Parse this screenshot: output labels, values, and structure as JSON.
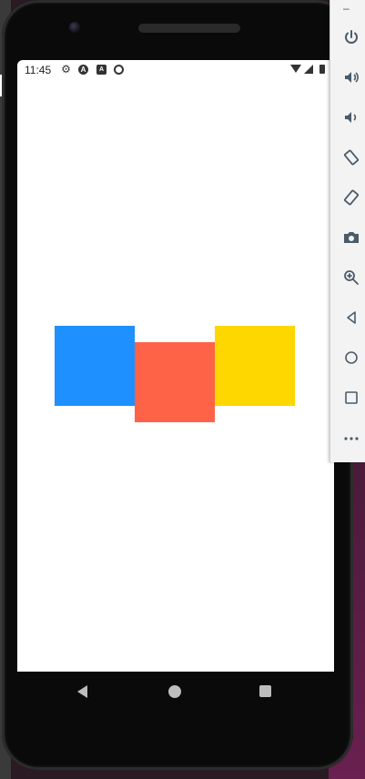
{
  "statusbar": {
    "time": "11:45",
    "icons": [
      "settings-icon",
      "a-icon",
      "a-box-icon",
      "sync-icon",
      "wifi-icon",
      "signal-icon",
      "battery-icon"
    ],
    "a_glyph": "A",
    "b_glyph": "A"
  },
  "app": {
    "boxes": [
      {
        "name": "blue-box",
        "color": "#1e90ff"
      },
      {
        "name": "red-box",
        "color": "#ff6347"
      },
      {
        "name": "yellow-box",
        "color": "#ffd700"
      }
    ]
  },
  "navbar": {
    "buttons": [
      "back-icon",
      "home-icon",
      "recents-icon"
    ]
  },
  "emulator_toolbar": {
    "minimize_label": "–",
    "buttons": [
      "power-icon",
      "volume-up-icon",
      "volume-down-icon",
      "rotate-left-icon",
      "rotate-right-icon",
      "camera-icon",
      "zoom-icon",
      "back-icon",
      "home-icon",
      "overview-icon",
      "more-icon"
    ]
  },
  "colors": {
    "blue": "#1e90ff",
    "red": "#ff6347",
    "yellow": "#ffd700",
    "toolbar_icon": "#4a5b6a"
  }
}
